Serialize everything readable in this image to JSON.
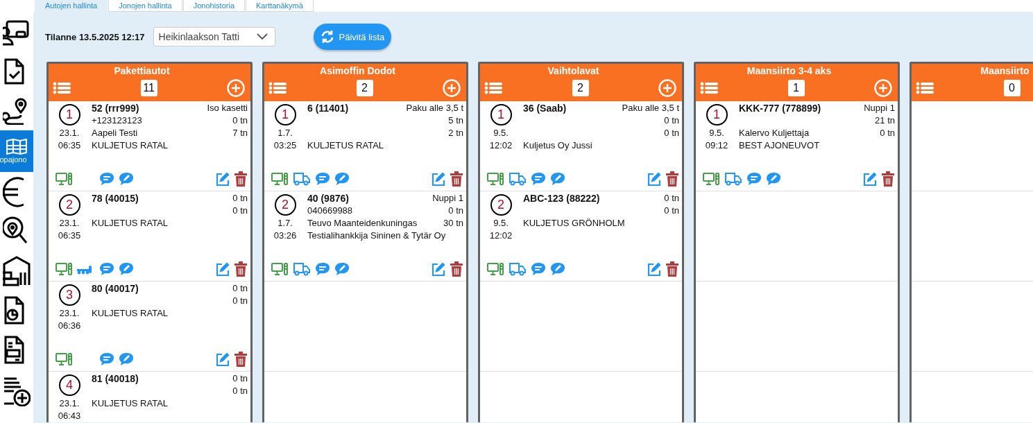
{
  "tabs": [
    {
      "label": "Autojen hallinta",
      "selected": true
    },
    {
      "label": "Jonojen hallinta",
      "selected": false
    },
    {
      "label": "Jonohistoria",
      "selected": false
    },
    {
      "label": "Karttanäkymä",
      "selected": false
    }
  ],
  "sidebar": {
    "items": [
      {
        "kind": "screen-user",
        "selected": false
      },
      {
        "kind": "doc-check",
        "selected": false
      },
      {
        "kind": "route",
        "selected": false
      },
      {
        "kind": "map",
        "label": "opajono",
        "selected": true
      },
      {
        "kind": "euro",
        "selected": false
      },
      {
        "kind": "search-pin",
        "selected": false
      },
      {
        "kind": "warehouse",
        "selected": false
      },
      {
        "kind": "doc-chart",
        "selected": false
      },
      {
        "kind": "doc-form",
        "selected": false
      },
      {
        "kind": "list-add",
        "selected": false
      }
    ]
  },
  "status": "Tilanne 13.5.2025 12:17",
  "dropdown": {
    "value": "Heikinlaakson Tatti"
  },
  "refresh_button": "Päivitä lista",
  "queues": [
    {
      "title": "Pakettiautot",
      "count": "11",
      "cards": [
        {
          "number": "1",
          "date": "23.1.",
          "time": "06:35",
          "title": "52 (rrr999)",
          "phone": "+123123123",
          "driver": "Aapeli Testi",
          "company": "KULJETUS RATAL",
          "right": [
            "Iso kasetti",
            "0 tn",
            "7 tn"
          ]
        },
        {
          "number": "2",
          "date": "23.1.",
          "time": "06:35",
          "title": "78 (40015)",
          "company": "KULJETUS RATAL",
          "right": [
            "0 tn",
            "0 tn"
          ],
          "trailer": true
        },
        {
          "number": "3",
          "date": "23.1.",
          "time": "06:36",
          "title": "80 (40017)",
          "company": "KULJETUS RATAL",
          "right": [
            "0 tn",
            "0 tn"
          ]
        },
        {
          "number": "4",
          "date": "23.1.",
          "time": "06:43",
          "title": "81 (40018)",
          "company": "KULJETUS RATAL",
          "right": [
            "0 tn",
            "0 tn"
          ]
        }
      ]
    },
    {
      "title": "Asimoffin Dodot",
      "count": "2",
      "cards": [
        {
          "number": "1",
          "date": "1.7.",
          "time": "03:25",
          "title": "6 (11401)",
          "company": "KULJETUS RATAL",
          "right": [
            "Paku alle 3,5 t",
            "5 tn",
            "2 tn"
          ],
          "truck": true
        },
        {
          "number": "2",
          "date": "1.7.",
          "time": "03:26",
          "title": "40 (9876)",
          "phone": "040669988",
          "driver": "Teuvo Maanteidenkuningas",
          "company": "Testialihankkija Sininen & Tytär Oy",
          "right": [
            "Nuppi 1",
            "0 tn",
            "30 tn"
          ],
          "truck": true
        }
      ]
    },
    {
      "title": "Vaihtolavat",
      "count": "2",
      "cards": [
        {
          "number": "1",
          "date": "9.5.",
          "time": "12:02",
          "title": "36 (Saab)",
          "company": "Kuljetus Oy Jussi",
          "right": [
            "Paku alle 3,5 t",
            "0 tn",
            "0 tn"
          ],
          "truck": true
        },
        {
          "number": "2",
          "date": "9.5.",
          "time": "12:02",
          "title": "ABC-123 (88222)",
          "company": "KULJETUS GRÖNHOLM",
          "right": [
            "0 tn",
            "0 tn"
          ],
          "truck": true
        }
      ]
    },
    {
      "title": "Maansiirto 3-4 aks",
      "count": "1",
      "cards": [
        {
          "number": "1",
          "date": "9.5.",
          "time": "09:12",
          "title": "KKK-777 (778899)",
          "driver": "Kalervo Kuljettaja",
          "company": "BEST AJONEUVOT",
          "right": [
            "Nuppi 1",
            "21 tn",
            "0 tn"
          ],
          "truck": true
        }
      ]
    },
    {
      "title": "Maansiirto",
      "count": "0"
    }
  ]
}
